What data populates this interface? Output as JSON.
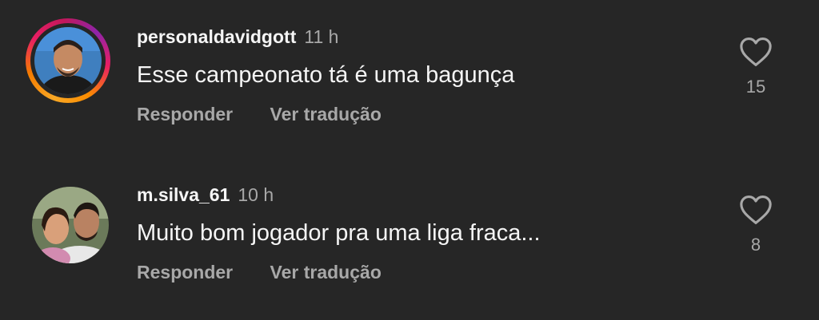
{
  "comments": [
    {
      "username": "personaldavidgott",
      "time": "11 h",
      "text": "Esse campeonato tá é uma bagunça",
      "reply_label": "Responder",
      "translate_label": "Ver tradução",
      "likes": "15",
      "has_story_ring": true
    },
    {
      "username": "m.silva_61",
      "time": "10 h",
      "text": "Muito bom jogador pra uma liga fraca...",
      "reply_label": "Responder",
      "translate_label": "Ver tradução",
      "likes": "8",
      "has_story_ring": false
    }
  ],
  "colors": {
    "background": "#262626",
    "primary_text": "#f5f5f5",
    "secondary_text": "#a8a8a8"
  }
}
